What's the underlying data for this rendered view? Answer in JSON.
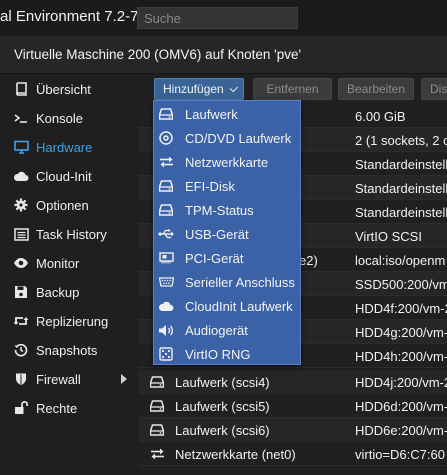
{
  "app": {
    "title": "al Environment 7.2-7"
  },
  "search": {
    "placeholder": "Suche"
  },
  "vm": {
    "title": "Virtuelle Maschine 200 (OMV6) auf Knoten 'pve'"
  },
  "sidebar": {
    "items": [
      {
        "label": "Übersicht",
        "icon": "book-icon"
      },
      {
        "label": "Konsole",
        "icon": "terminal-icon"
      },
      {
        "label": "Hardware",
        "icon": "monitor-icon",
        "active": true
      },
      {
        "label": "Cloud-Init",
        "icon": "cloud-icon"
      },
      {
        "label": "Optionen",
        "icon": "gear-icon"
      },
      {
        "label": "Task History",
        "icon": "list-icon"
      },
      {
        "label": "Monitor",
        "icon": "eye-icon"
      },
      {
        "label": "Backup",
        "icon": "floppy-icon"
      },
      {
        "label": "Replizierung",
        "icon": "retweet-icon"
      },
      {
        "label": "Snapshots",
        "icon": "history-icon"
      },
      {
        "label": "Firewall",
        "icon": "shield-icon"
      },
      {
        "label": "Rechte",
        "icon": "unlock-icon"
      }
    ]
  },
  "toolbar": {
    "add_label": "Hinzufügen",
    "remove_label": "Entfernen",
    "edit_label": "Bearbeiten",
    "disk_label": "Dis"
  },
  "hardware": {
    "rows": [
      {
        "name": "",
        "value": "6.00 GiB"
      },
      {
        "name": "",
        "value": "2 (1 sockets, 2 c"
      },
      {
        "name": "",
        "value": "Standardeinstell"
      },
      {
        "name": "",
        "value": "Standardeinstell"
      },
      {
        "name": "",
        "value": "Standardeinstell"
      },
      {
        "name": "",
        "value": "VirtIO SCSI"
      },
      {
        "name": "e2)",
        "value": "local:iso/openm"
      },
      {
        "name": "",
        "value": "SSD500:200/vm"
      },
      {
        "name": "",
        "value": "HDD4f:200/vm-2"
      },
      {
        "name": "",
        "value": "HDD4g:200/vm-2"
      },
      {
        "name": "",
        "value": "HDD4h:200/vm-2"
      },
      {
        "name": "Laufwerk (scsi4)",
        "value": "HDD4j:200/vm-2",
        "icon": "drive-icon"
      },
      {
        "name": "Laufwerk (scsi5)",
        "value": "HDD6d:200/vm-",
        "icon": "drive-icon"
      },
      {
        "name": "Laufwerk (scsi6)",
        "value": "HDD6e:200/vm-",
        "icon": "drive-icon"
      },
      {
        "name": "Netzwerkkarte (net0)",
        "value": "virtio=D6:C7:60",
        "icon": "exchange-icon"
      }
    ]
  },
  "add_menu": {
    "items": [
      {
        "label": "Laufwerk",
        "icon": "drive-icon"
      },
      {
        "label": "CD/DVD Laufwerk",
        "icon": "disc-icon"
      },
      {
        "label": "Netzwerkkarte",
        "icon": "exchange-icon"
      },
      {
        "label": "EFI-Disk",
        "icon": "drive-icon"
      },
      {
        "label": "TPM-Status",
        "icon": "drive-icon"
      },
      {
        "label": "USB-Gerät",
        "icon": "usb-icon"
      },
      {
        "label": "PCI-Gerät",
        "icon": "pci-card-icon"
      },
      {
        "label": "Serieller Anschluss",
        "icon": "serial-port-icon"
      },
      {
        "label": "CloudInit Laufwerk",
        "icon": "cloud-icon"
      },
      {
        "label": "Audiogerät",
        "icon": "volume-icon"
      },
      {
        "label": "VirtIO RNG",
        "icon": "dice-icon"
      }
    ]
  }
}
